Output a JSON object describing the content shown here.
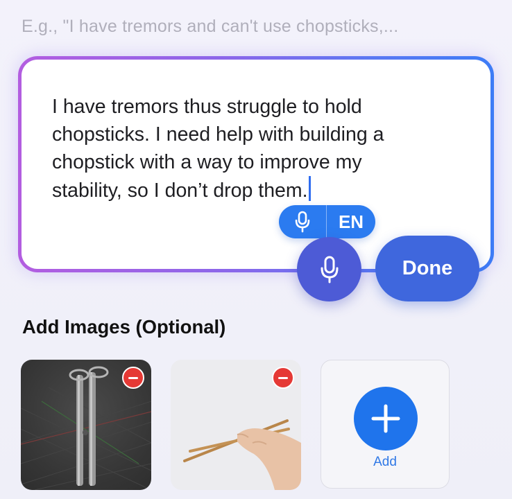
{
  "prompt_hint": "E.g., \"I have tremors and can't use chopsticks,...",
  "editor": {
    "text": "I have tremors thus struggle to hold chopsticks. I need help with building a chopstick with a way to improve my stability, so I don’t drop them."
  },
  "dictation": {
    "language": "EN",
    "mic_icon": "microphone-icon"
  },
  "actions": {
    "mic_icon": "microphone-icon",
    "done_label": "Done"
  },
  "images_section": {
    "title": "Add Images (Optional)",
    "thumbnails": [
      {
        "alt": "3D model of two chopsticks with ring holders",
        "remove_icon": "minus-circle-icon"
      },
      {
        "alt": "Hand holding wooden chopsticks",
        "remove_icon": "minus-circle-icon"
      }
    ],
    "add_label": "Add",
    "add_icon": "plus-icon"
  },
  "colors": {
    "accent": "#2b7bf0",
    "mic_button": "#4d5bd6",
    "done_button": "#3f67dd",
    "remove_badge": "#e53935"
  }
}
